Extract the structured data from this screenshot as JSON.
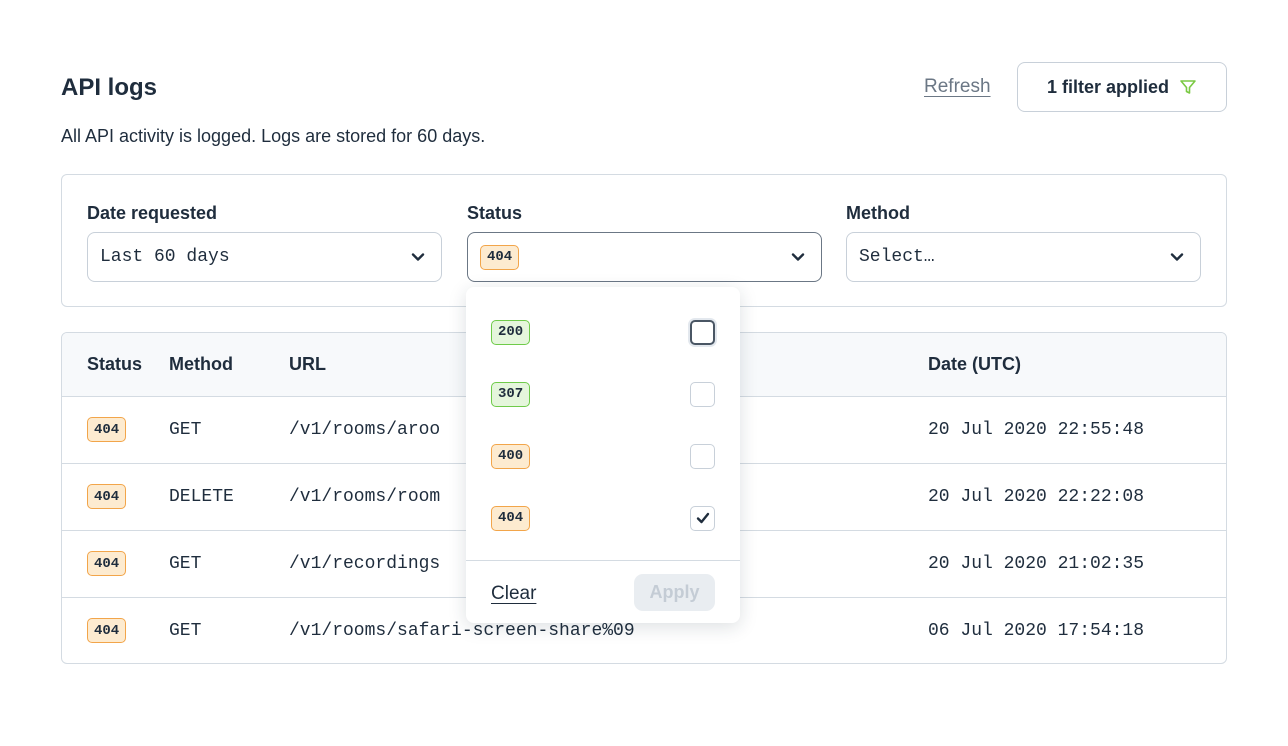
{
  "header": {
    "title": "API logs",
    "refresh_label": "Refresh",
    "filter_button_label": "1 filter applied",
    "subtitle": "All API activity is logged. Logs are stored for 60 days."
  },
  "filters": {
    "date": {
      "label": "Date requested",
      "value": "Last 60 days"
    },
    "status": {
      "label": "Status",
      "value": "404"
    },
    "method": {
      "label": "Method",
      "value": "Select…"
    }
  },
  "table": {
    "columns": [
      "Status",
      "Method",
      "URL",
      "Date (UTC)"
    ],
    "rows": [
      {
        "status": "404",
        "method": "GET",
        "url": "/v1/rooms/aroo",
        "date": "20 Jul 2020 22:55:48"
      },
      {
        "status": "404",
        "method": "DELETE",
        "url": "/v1/rooms/room",
        "date": "20 Jul 2020 22:22:08"
      },
      {
        "status": "404",
        "method": "GET",
        "url": "/v1/recordings",
        "date": "20 Jul 2020 21:02:35"
      },
      {
        "status": "404",
        "method": "GET",
        "url": "/v1/rooms/safari-screen-share%09",
        "date": "06 Jul 2020 17:54:18"
      }
    ]
  },
  "status_dropdown": {
    "options": [
      {
        "code": "200",
        "checked": false
      },
      {
        "code": "307",
        "checked": false
      },
      {
        "code": "400",
        "checked": false
      },
      {
        "code": "404",
        "checked": true
      }
    ],
    "clear_label": "Clear",
    "apply_label": "Apply"
  },
  "colors": {
    "warn_badge_border": "#f2a54a",
    "warn_badge_bg": "#fdebd0",
    "ok_badge_border": "#6fcb4a",
    "ok_badge_bg": "#e5f6dc",
    "filter_icon": "#7ac943"
  },
  "icons": {
    "filter_button": "filter-funnel-icon",
    "select_chevron": "chevron-down-icon",
    "checkbox_check": "checkmark-icon"
  }
}
